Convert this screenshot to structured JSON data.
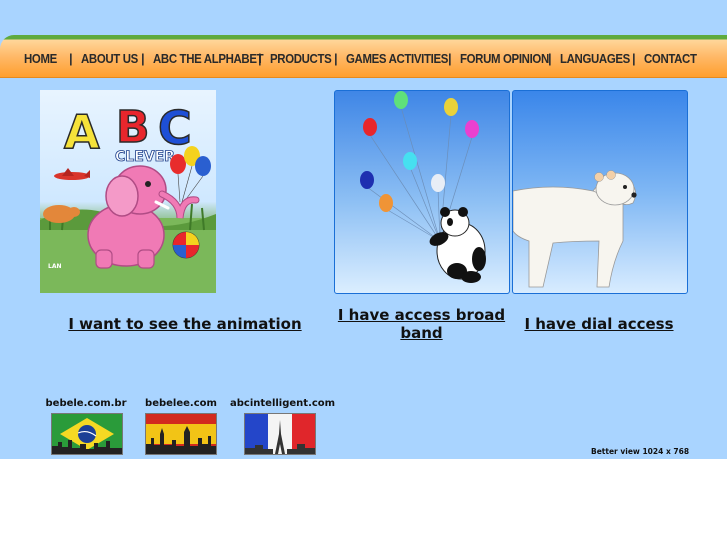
{
  "nav": {
    "items": [
      {
        "label": "HOME"
      },
      {
        "label": "ABOUT US"
      },
      {
        "label": "ABC THE ALPHABET"
      },
      {
        "label": "PRODUCTS"
      },
      {
        "label": "GAMES ACTIVITIES"
      },
      {
        "label": "FORUM OPINION"
      },
      {
        "label": "LANGUAGES"
      },
      {
        "label": "CONTACT"
      }
    ],
    "separator": "|"
  },
  "cover": {
    "letters": [
      "A",
      "B",
      "C"
    ],
    "word": "CLEVER",
    "publisher": "LAN"
  },
  "links": {
    "animation": "I want to see the animation",
    "broadband": "I have access broad band",
    "dial": "I have dial access"
  },
  "sites": [
    {
      "label": "bebele.com.br",
      "flag": "brazil-flag"
    },
    {
      "label": "bebelee.com",
      "flag": "spain-flag"
    },
    {
      "label": "abcintelligent.com",
      "flag": "france-flag"
    }
  ],
  "footer": {
    "better_view": "Better view 1024 x 768"
  },
  "colors": {
    "background": "#a9d4ff",
    "nav_orange": "#ffb866",
    "nav_green": "#5faa3e"
  }
}
